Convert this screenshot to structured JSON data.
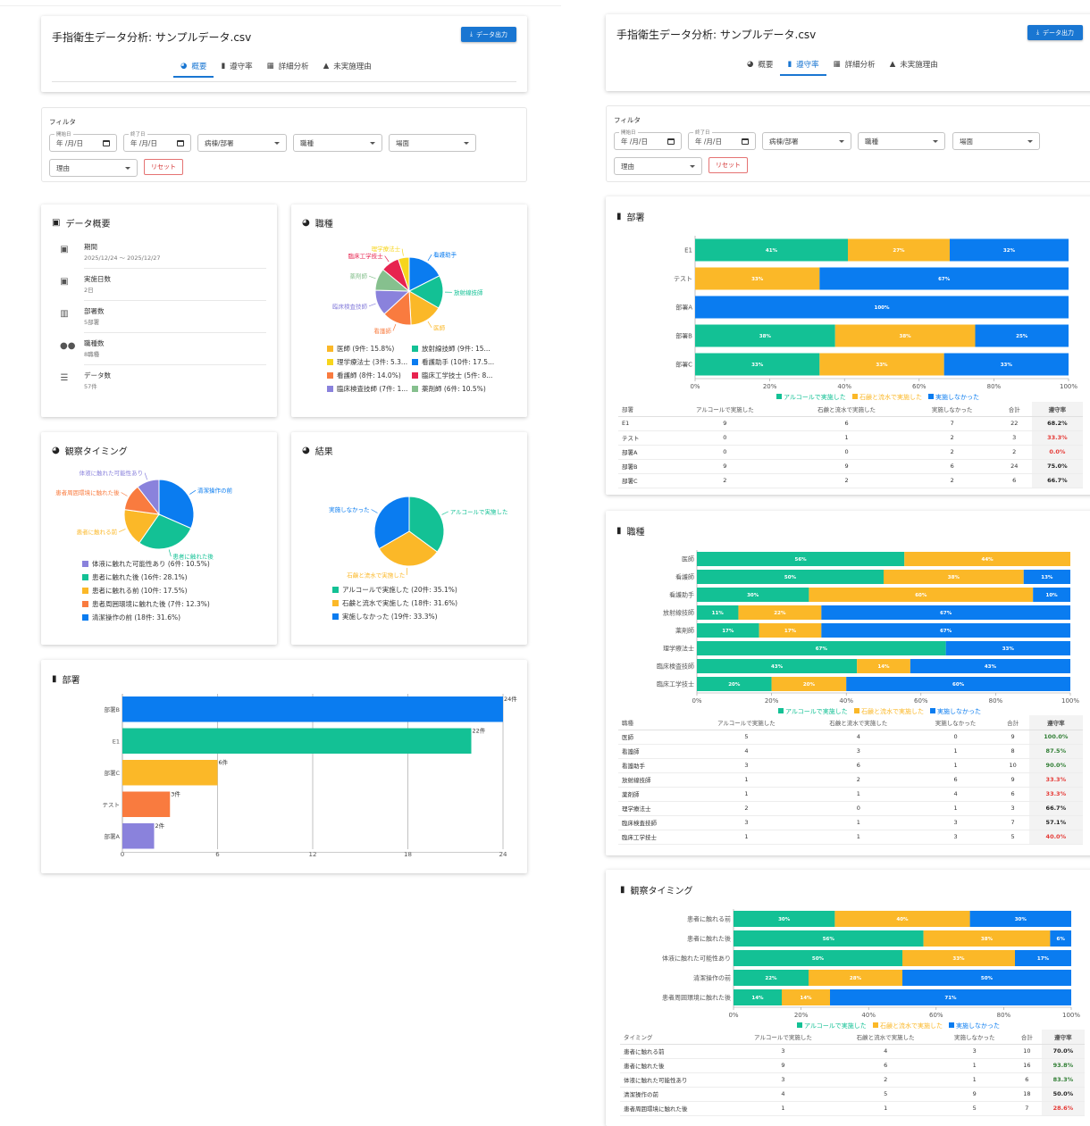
{
  "header": {
    "title": "手指衛生データ分析: サンプルデータ.csv",
    "export_label": "データ出力"
  },
  "tabs": [
    {
      "label": "概要"
    },
    {
      "label": "遵守率"
    },
    {
      "label": "詳細分析"
    },
    {
      "label": "未実施理由"
    }
  ],
  "filter": {
    "heading": "フィルタ",
    "start_label": "開始日",
    "end_label": "終了日",
    "date_placeholder": "年 /月/日",
    "ward": "病棟/部署",
    "job": "職種",
    "scene": "場面",
    "reason": "理由",
    "reset": "リセット"
  },
  "summary": {
    "heading": "データ概要",
    "rows": [
      {
        "icon": "calendar-icon",
        "key": "期間",
        "value": "2025/12/24 〜 2025/12/27"
      },
      {
        "icon": "calendar-icon",
        "key": "実施日数",
        "value": "2日"
      },
      {
        "icon": "building-icon",
        "key": "部署数",
        "value": "5部署"
      },
      {
        "icon": "people-icon",
        "key": "職種数",
        "value": "8職種"
      },
      {
        "icon": "list-icon",
        "key": "データ数",
        "value": "57件"
      }
    ]
  },
  "colors": {
    "green": "#13c195",
    "orange": "#fbb828",
    "blue": "#0a7cf0",
    "red_orange": "#f97b3f",
    "purple": "#8a82dc",
    "pink": "#e7234f",
    "yellow": "#f7d51c",
    "sage": "#86c08e",
    "accent": "#1976d2"
  },
  "job_pie": {
    "heading": "職種",
    "slices": [
      {
        "label": "看護助手",
        "value": 10,
        "color": "#0a7cf0"
      },
      {
        "label": "放射線技師",
        "value": 9,
        "color": "#13c195"
      },
      {
        "label": "医師",
        "value": 9,
        "color": "#fbb828"
      },
      {
        "label": "看護師",
        "value": 8,
        "color": "#f97b3f"
      },
      {
        "label": "臨床検査技師",
        "value": 7,
        "color": "#8a82dc"
      },
      {
        "label": "薬剤師",
        "value": 6,
        "color": "#86c08e"
      },
      {
        "label": "臨床工学技士",
        "value": 5,
        "color": "#e7234f"
      },
      {
        "label": "理学療法士",
        "value": 3,
        "color": "#f7d51c"
      }
    ],
    "legend": [
      {
        "text": "医師 (9件: 15.8%)",
        "color": "#fbb828"
      },
      {
        "text": "放射線技師 (9件: 15...",
        "color": "#13c195"
      },
      {
        "text": "理学療法士 (3件: 5.3...",
        "color": "#f7d51c"
      },
      {
        "text": "看護助手 (10件: 17.5...",
        "color": "#0a7cf0"
      },
      {
        "text": "看護師 (8件: 14.0%)",
        "color": "#f97b3f"
      },
      {
        "text": "臨床工学技士 (5件: 8...",
        "color": "#e7234f"
      },
      {
        "text": "臨床検査技師 (7件: 1...",
        "color": "#8a82dc"
      },
      {
        "text": "薬剤師 (6件: 10.5%)",
        "color": "#86c08e"
      }
    ]
  },
  "timing_pie": {
    "heading": "観察タイミング",
    "slices": [
      {
        "label": "清潔操作の前",
        "value": 18,
        "color": "#0a7cf0"
      },
      {
        "label": "患者に触れた後",
        "value": 16,
        "color": "#13c195"
      },
      {
        "label": "患者に触れる前",
        "value": 10,
        "color": "#fbb828"
      },
      {
        "label": "患者周囲環境に触れた後",
        "value": 7,
        "color": "#f97b3f"
      },
      {
        "label": "体液に触れた可能性あり",
        "value": 6,
        "color": "#8a82dc"
      }
    ],
    "legend": [
      {
        "text": "体液に触れた可能性あり (6件: 10.5%)",
        "color": "#8a82dc"
      },
      {
        "text": "患者に触れた後 (16件: 28.1%)",
        "color": "#13c195"
      },
      {
        "text": "患者に触れる前 (10件: 17.5%)",
        "color": "#fbb828"
      },
      {
        "text": "患者周囲環境に触れた後 (7件: 12.3%)",
        "color": "#f97b3f"
      },
      {
        "text": "清潔操作の前 (18件: 31.6%)",
        "color": "#0a7cf0"
      }
    ]
  },
  "result_pie": {
    "heading": "結果",
    "slices": [
      {
        "label": "アルコールで実施した",
        "value": 20,
        "color": "#13c195"
      },
      {
        "label": "石鹸と流水で実施した",
        "value": 18,
        "color": "#fbb828"
      },
      {
        "label": "実施しなかった",
        "value": 19,
        "color": "#0a7cf0"
      }
    ],
    "legend": [
      {
        "text": "アルコールで実施した (20件: 35.1%)",
        "color": "#13c195"
      },
      {
        "text": "石鹸と流水で実施した (18件: 31.6%)",
        "color": "#fbb828"
      },
      {
        "text": "実施しなかった (19件: 33.3%)",
        "color": "#0a7cf0"
      }
    ]
  },
  "dept_count": {
    "heading": "部署",
    "unit": "件",
    "bars": [
      {
        "label": "部署B",
        "value": 24,
        "color": "#0a7cf0"
      },
      {
        "label": "E1",
        "value": 22,
        "color": "#13c195"
      },
      {
        "label": "部署C",
        "value": 6,
        "color": "#fbb828"
      },
      {
        "label": "テスト",
        "value": 3,
        "color": "#f97b3f"
      },
      {
        "label": "部署A",
        "value": 2,
        "color": "#8a82dc"
      }
    ],
    "ticks": [
      0,
      6,
      12,
      18,
      24
    ]
  },
  "stack_legend": [
    "アルコールで実施した",
    "石鹸と流水で実施した",
    "実施しなかった"
  ],
  "pct_ticks": [
    "0%",
    "20%",
    "40%",
    "60%",
    "80%",
    "100%"
  ],
  "dept_rate": {
    "heading": "部署",
    "col0": "部署",
    "headers": [
      "アルコールで実施した",
      "石鹸と流水で実施した",
      "実施しなかった",
      "合計",
      "遵守率"
    ],
    "rows": [
      {
        "name": "E1",
        "a": 9,
        "s": 6,
        "n": 7,
        "t": 22,
        "r": "68.2%",
        "cls": "mid"
      },
      {
        "name": "テスト",
        "a": 0,
        "s": 1,
        "n": 2,
        "t": 3,
        "r": "33.3%",
        "cls": "bad"
      },
      {
        "name": "部署A",
        "a": 0,
        "s": 0,
        "n": 2,
        "t": 2,
        "r": "0.0%",
        "cls": "bad"
      },
      {
        "name": "部署B",
        "a": 9,
        "s": 9,
        "n": 6,
        "t": 24,
        "r": "75.0%",
        "cls": "mid"
      },
      {
        "name": "部署C",
        "a": 2,
        "s": 2,
        "n": 2,
        "t": 6,
        "r": "66.7%",
        "cls": "mid"
      }
    ]
  },
  "job_rate": {
    "heading": "職種",
    "col0": "職種",
    "headers": [
      "アルコールで実施した",
      "石鹸と流水で実施した",
      "実施しなかった",
      "合計",
      "遵守率"
    ],
    "rows": [
      {
        "name": "医師",
        "a": 5,
        "s": 4,
        "n": 0,
        "t": 9,
        "r": "100.0%",
        "cls": "good"
      },
      {
        "name": "看護師",
        "a": 4,
        "s": 3,
        "n": 1,
        "t": 8,
        "r": "87.5%",
        "cls": "good"
      },
      {
        "name": "看護助手",
        "a": 3,
        "s": 6,
        "n": 1,
        "t": 10,
        "r": "90.0%",
        "cls": "good"
      },
      {
        "name": "放射線技師",
        "a": 1,
        "s": 2,
        "n": 6,
        "t": 9,
        "r": "33.3%",
        "cls": "bad"
      },
      {
        "name": "薬剤師",
        "a": 1,
        "s": 1,
        "n": 4,
        "t": 6,
        "r": "33.3%",
        "cls": "bad"
      },
      {
        "name": "理学療法士",
        "a": 2,
        "s": 0,
        "n": 1,
        "t": 3,
        "r": "66.7%",
        "cls": "mid"
      },
      {
        "name": "臨床検査技師",
        "a": 3,
        "s": 1,
        "n": 3,
        "t": 7,
        "r": "57.1%",
        "cls": "mid"
      },
      {
        "name": "臨床工学技士",
        "a": 1,
        "s": 1,
        "n": 3,
        "t": 5,
        "r": "40.0%",
        "cls": "bad"
      }
    ]
  },
  "timing_rate": {
    "heading": "観察タイミング",
    "col0": "タイミング",
    "headers": [
      "アルコールで実施した",
      "石鹸と流水で実施した",
      "実施しなかった",
      "合計",
      "遵守率"
    ],
    "rows": [
      {
        "name": "患者に触れる前",
        "a": 3,
        "s": 4,
        "n": 3,
        "t": 10,
        "r": "70.0%",
        "cls": "mid"
      },
      {
        "name": "患者に触れた後",
        "a": 9,
        "s": 6,
        "n": 1,
        "t": 16,
        "r": "93.8%",
        "cls": "good"
      },
      {
        "name": "体液に触れた可能性あり",
        "a": 3,
        "s": 2,
        "n": 1,
        "t": 6,
        "r": "83.3%",
        "cls": "good"
      },
      {
        "name": "清潔操作の前",
        "a": 4,
        "s": 5,
        "n": 9,
        "t": 18,
        "r": "50.0%",
        "cls": "mid"
      },
      {
        "name": "患者周囲環境に触れた後",
        "a": 1,
        "s": 1,
        "n": 5,
        "t": 7,
        "r": "28.6%",
        "cls": "bad"
      }
    ]
  }
}
